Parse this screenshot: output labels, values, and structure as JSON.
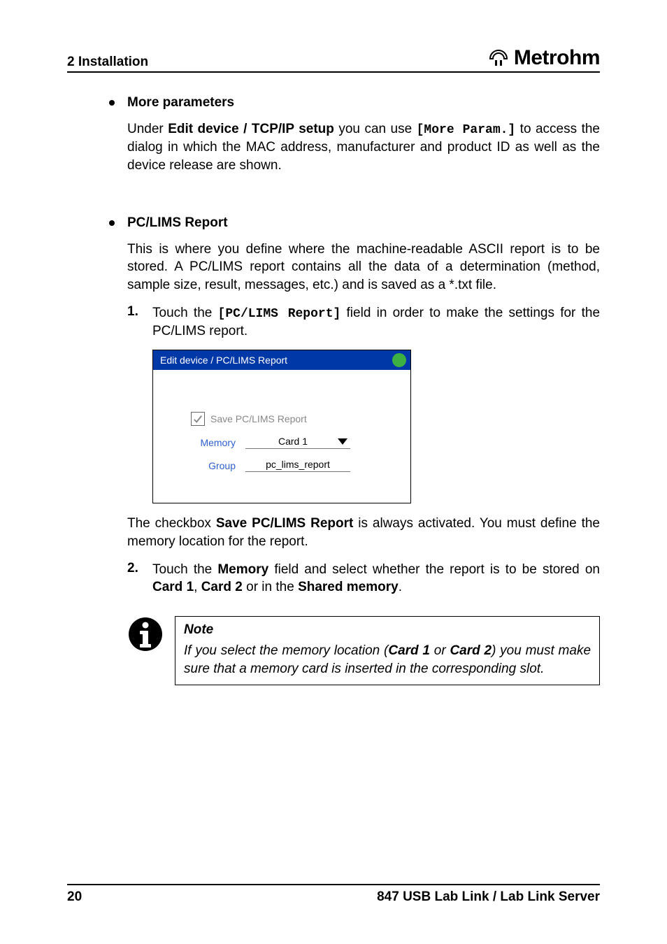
{
  "header": {
    "section": "2 Installation",
    "brand": "Metrohm"
  },
  "bullets": {
    "more_params": {
      "title": "More parameters",
      "text_prefix": "Under ",
      "bold1": "Edit device / TCP/IP setup",
      "text_mid1": " you can use ",
      "mono1": "[More Param.]",
      "text_suffix": " to access the dialog in which the MAC address, manufacturer and product ID as well as the device release are shown."
    },
    "pc_lims": {
      "title": "PC/LIMS Report",
      "intro": "This is where you define where the machine-readable ASCII report is to be stored. A PC/LIMS report contains all the data of a determination (method, sample size, result, messages, etc.) and is saved as a *.txt file."
    }
  },
  "steps": {
    "s1": {
      "num": "1.",
      "t1": "Touch the ",
      "mono": "[PC/LIMS Report]",
      "t2": " field in order to make the settings for the PC/LIMS report."
    },
    "after_shot_p1": "The checkbox ",
    "after_shot_b1": "Save PC/LIMS Report",
    "after_shot_p2": " is always activated. You must define the memory location for the report.",
    "s2": {
      "num": "2.",
      "t1": "Touch the ",
      "b1": "Memory",
      "t2": " field and select whether the report is to be stored on ",
      "b2": "Card 1",
      "t3": ", ",
      "b3": "Card 2",
      "t4": " or in the ",
      "b4": "Shared memory",
      "t5": "."
    }
  },
  "device": {
    "titlebar": "Edit device / PC/LIMS Report",
    "save_label": "Save PC/LIMS Report",
    "memory_label": "Memory",
    "memory_value": "Card 1",
    "group_label": "Group",
    "group_value": "pc_lims_report"
  },
  "note": {
    "title": "Note",
    "p1": "If you select the memory location (",
    "b1": "Card 1",
    "p2": " or ",
    "b2": "Card 2",
    "p3": ") you must make sure that a memory card is inserted in the corresponding slot."
  },
  "footer": {
    "page": "20",
    "doc": "847 USB Lab Link / Lab Link Server"
  }
}
